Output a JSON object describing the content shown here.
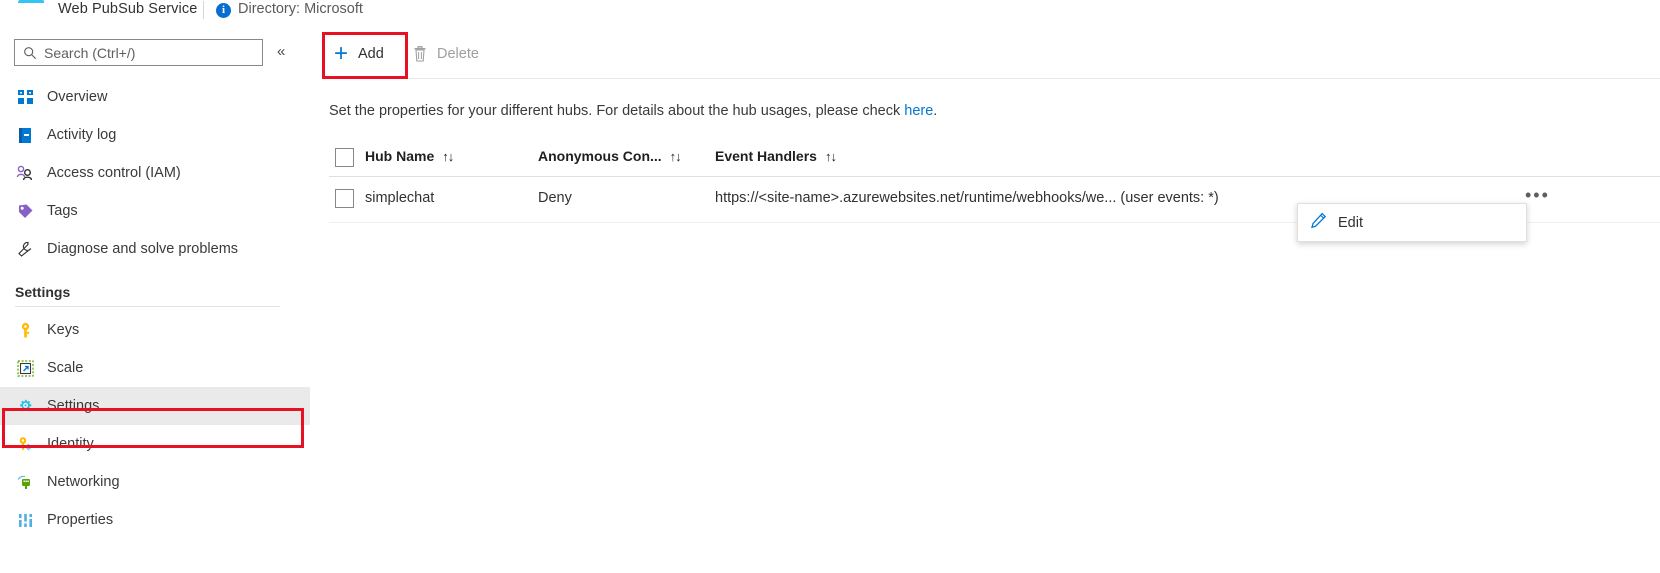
{
  "header": {
    "logo_icon": "azure-web-pubsub-logo-icon",
    "service_title": "Web PubSub Service",
    "info_icon": "info-icon",
    "info_glyph": "i",
    "directory_text": "Directory: Microsoft"
  },
  "sidebar": {
    "search": {
      "placeholder": "Search (Ctrl+/)",
      "icon": "search-icon"
    },
    "collapse_icon": "chevron-double-left-icon",
    "collapse_glyph": "«",
    "items": [
      {
        "label": "Overview",
        "icon": "overview-grid-icon",
        "selected": false
      },
      {
        "label": "Activity log",
        "icon": "activity-log-icon",
        "selected": false
      },
      {
        "label": "Access control (IAM)",
        "icon": "access-control-people-icon",
        "selected": false
      },
      {
        "label": "Tags",
        "icon": "tag-icon",
        "selected": false
      },
      {
        "label": "Diagnose and solve problems",
        "icon": "wrench-icon",
        "selected": false
      }
    ],
    "section_title": "Settings",
    "settings_items": [
      {
        "label": "Keys",
        "icon": "key-icon",
        "selected": false
      },
      {
        "label": "Scale",
        "icon": "scale-arrow-icon",
        "selected": false
      },
      {
        "label": "Settings",
        "icon": "gear-icon",
        "selected": true
      },
      {
        "label": "Identity",
        "icon": "identity-key-icon",
        "selected": false
      },
      {
        "label": "Networking",
        "icon": "networking-icon",
        "selected": false
      },
      {
        "label": "Properties",
        "icon": "properties-bars-icon",
        "selected": false
      }
    ]
  },
  "toolbar": {
    "add_label": "Add",
    "add_icon": "plus-icon",
    "delete_label": "Delete",
    "delete_icon": "trash-icon"
  },
  "content": {
    "description_prefix": "Set the properties for your different hubs. For details about the hub usages, please check ",
    "description_link": "here",
    "description_suffix": "."
  },
  "table": {
    "select_all_checkbox": "select-all-checkbox",
    "sort_glyph": "↑↓",
    "columns": [
      {
        "label": "Hub Name",
        "sortable": true
      },
      {
        "label": "Anonymous Con...",
        "sortable": true
      },
      {
        "label": "Event Handlers",
        "sortable": true
      }
    ],
    "rows": [
      {
        "hub_name": "simplechat",
        "anonymous_connect": "Deny",
        "event_handlers": "https://<site-name>.azurewebsites.net/runtime/webhooks/we... (user events: *)",
        "more_glyph": "•••"
      }
    ]
  },
  "context_menu": {
    "items": [
      {
        "label": "Edit",
        "icon": "pencil-edit-icon"
      }
    ]
  },
  "annotations": {
    "highlights": [
      {
        "target": "add-button",
        "color": "#e81123"
      },
      {
        "target": "sidebar-item-settings",
        "color": "#e81123"
      }
    ]
  },
  "colors": {
    "accent": "#0078d4",
    "highlight": "#e81123",
    "selected_row_bg": "#eaeaea",
    "text": "#323130"
  }
}
